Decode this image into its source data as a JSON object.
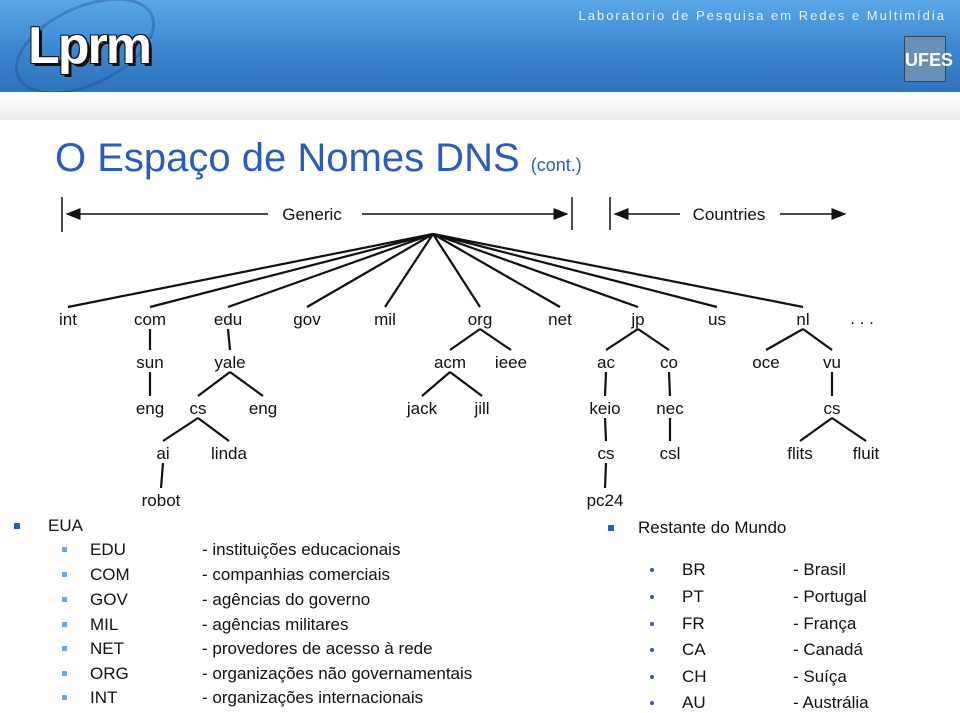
{
  "header": {
    "logo": "Lprm",
    "lab": "Laboratorio de Pesquisa em Redes e Multimídia",
    "seal": "UFES"
  },
  "title": {
    "main": "O Espaço de Nomes DNS",
    "suffix": "(cont.)"
  },
  "diagram": {
    "generic_label": "Generic",
    "countries_label": "Countries",
    "ellipsis": ". . .",
    "nodes": [
      {
        "id": "int",
        "label": "int",
        "parent": "root"
      },
      {
        "id": "com",
        "label": "com",
        "parent": "root"
      },
      {
        "id": "edu",
        "label": "edu",
        "parent": "root"
      },
      {
        "id": "gov",
        "label": "gov",
        "parent": "root"
      },
      {
        "id": "mil",
        "label": "mil",
        "parent": "root"
      },
      {
        "id": "org",
        "label": "org",
        "parent": "root"
      },
      {
        "id": "net",
        "label": "net",
        "parent": "root"
      },
      {
        "id": "jp",
        "label": "jp",
        "parent": "root"
      },
      {
        "id": "us",
        "label": "us",
        "parent": "root"
      },
      {
        "id": "nl",
        "label": "nl",
        "parent": "root"
      },
      {
        "id": "sun",
        "label": "sun",
        "parent": "com"
      },
      {
        "id": "yale",
        "label": "yale",
        "parent": "edu"
      },
      {
        "id": "acm",
        "label": "acm",
        "parent": "org"
      },
      {
        "id": "ieee",
        "label": "ieee",
        "parent": "org"
      },
      {
        "id": "ac",
        "label": "ac",
        "parent": "jp"
      },
      {
        "id": "co",
        "label": "co",
        "parent": "jp"
      },
      {
        "id": "oce",
        "label": "oce",
        "parent": "nl"
      },
      {
        "id": "vu",
        "label": "vu",
        "parent": "nl"
      },
      {
        "id": "eng1",
        "label": "eng",
        "parent": "sun"
      },
      {
        "id": "cs1",
        "label": "cs",
        "parent": "yale"
      },
      {
        "id": "eng2",
        "label": "eng",
        "parent": "yale"
      },
      {
        "id": "jack",
        "label": "jack",
        "parent": "acm"
      },
      {
        "id": "jill",
        "label": "jill",
        "parent": "acm"
      },
      {
        "id": "keio",
        "label": "keio",
        "parent": "ac"
      },
      {
        "id": "nec",
        "label": "nec",
        "parent": "co"
      },
      {
        "id": "cs3",
        "label": "cs",
        "parent": "vu"
      },
      {
        "id": "ai",
        "label": "ai",
        "parent": "cs1"
      },
      {
        "id": "linda",
        "label": "linda",
        "parent": "cs1"
      },
      {
        "id": "cs2",
        "label": "cs",
        "parent": "keio"
      },
      {
        "id": "csl",
        "label": "csl",
        "parent": "nec"
      },
      {
        "id": "flits",
        "label": "flits",
        "parent": "cs3"
      },
      {
        "id": "fluit",
        "label": "fluit",
        "parent": "cs3"
      },
      {
        "id": "robot",
        "label": "robot",
        "parent": "ai"
      },
      {
        "id": "pc24",
        "label": "pc24",
        "parent": "cs2"
      }
    ]
  },
  "left_list": {
    "heading": "EUA",
    "items": [
      {
        "code": "EDU",
        "desc": "- instituições educacionais"
      },
      {
        "code": "COM",
        "desc": "- companhias comerciais"
      },
      {
        "code": "GOV",
        "desc": "- agências do governo"
      },
      {
        "code": "MIL",
        "desc": "- agências militares"
      },
      {
        "code": "NET",
        "desc": "- provedores de acesso à rede"
      },
      {
        "code": "ORG",
        "desc": "- organizações não governamentais"
      },
      {
        "code": "INT",
        "desc": "- organizações internacionais"
      }
    ]
  },
  "right_list": {
    "heading": "Restante do Mundo",
    "items": [
      {
        "code": "BR",
        "desc": "- Brasil"
      },
      {
        "code": "PT",
        "desc": "- Portugal"
      },
      {
        "code": "FR",
        "desc": "- França"
      },
      {
        "code": "CA",
        "desc": "- Canadá"
      },
      {
        "code": "CH",
        "desc": "- Suíça"
      },
      {
        "code": "AU",
        "desc": "- Austrália"
      }
    ]
  },
  "colors": {
    "title": "#2a5cb8",
    "header": "#3c86cf"
  }
}
